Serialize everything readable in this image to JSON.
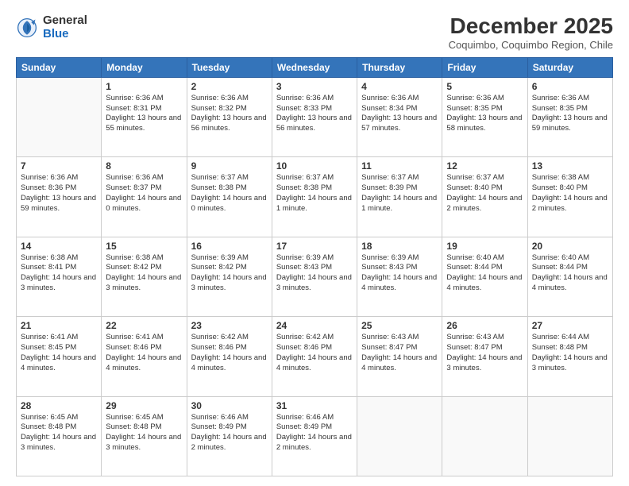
{
  "logo": {
    "general": "General",
    "blue": "Blue"
  },
  "header": {
    "month": "December 2025",
    "location": "Coquimbo, Coquimbo Region, Chile"
  },
  "weekdays": [
    "Sunday",
    "Monday",
    "Tuesday",
    "Wednesday",
    "Thursday",
    "Friday",
    "Saturday"
  ],
  "weeks": [
    [
      {
        "day": "",
        "sunrise": "",
        "sunset": "",
        "daylight": ""
      },
      {
        "day": "1",
        "sunrise": "Sunrise: 6:36 AM",
        "sunset": "Sunset: 8:31 PM",
        "daylight": "Daylight: 13 hours and 55 minutes."
      },
      {
        "day": "2",
        "sunrise": "Sunrise: 6:36 AM",
        "sunset": "Sunset: 8:32 PM",
        "daylight": "Daylight: 13 hours and 56 minutes."
      },
      {
        "day": "3",
        "sunrise": "Sunrise: 6:36 AM",
        "sunset": "Sunset: 8:33 PM",
        "daylight": "Daylight: 13 hours and 56 minutes."
      },
      {
        "day": "4",
        "sunrise": "Sunrise: 6:36 AM",
        "sunset": "Sunset: 8:34 PM",
        "daylight": "Daylight: 13 hours and 57 minutes."
      },
      {
        "day": "5",
        "sunrise": "Sunrise: 6:36 AM",
        "sunset": "Sunset: 8:35 PM",
        "daylight": "Daylight: 13 hours and 58 minutes."
      },
      {
        "day": "6",
        "sunrise": "Sunrise: 6:36 AM",
        "sunset": "Sunset: 8:35 PM",
        "daylight": "Daylight: 13 hours and 59 minutes."
      }
    ],
    [
      {
        "day": "7",
        "sunrise": "Sunrise: 6:36 AM",
        "sunset": "Sunset: 8:36 PM",
        "daylight": "Daylight: 13 hours and 59 minutes."
      },
      {
        "day": "8",
        "sunrise": "Sunrise: 6:36 AM",
        "sunset": "Sunset: 8:37 PM",
        "daylight": "Daylight: 14 hours and 0 minutes."
      },
      {
        "day": "9",
        "sunrise": "Sunrise: 6:37 AM",
        "sunset": "Sunset: 8:38 PM",
        "daylight": "Daylight: 14 hours and 0 minutes."
      },
      {
        "day": "10",
        "sunrise": "Sunrise: 6:37 AM",
        "sunset": "Sunset: 8:38 PM",
        "daylight": "Daylight: 14 hours and 1 minute."
      },
      {
        "day": "11",
        "sunrise": "Sunrise: 6:37 AM",
        "sunset": "Sunset: 8:39 PM",
        "daylight": "Daylight: 14 hours and 1 minute."
      },
      {
        "day": "12",
        "sunrise": "Sunrise: 6:37 AM",
        "sunset": "Sunset: 8:40 PM",
        "daylight": "Daylight: 14 hours and 2 minutes."
      },
      {
        "day": "13",
        "sunrise": "Sunrise: 6:38 AM",
        "sunset": "Sunset: 8:40 PM",
        "daylight": "Daylight: 14 hours and 2 minutes."
      }
    ],
    [
      {
        "day": "14",
        "sunrise": "Sunrise: 6:38 AM",
        "sunset": "Sunset: 8:41 PM",
        "daylight": "Daylight: 14 hours and 3 minutes."
      },
      {
        "day": "15",
        "sunrise": "Sunrise: 6:38 AM",
        "sunset": "Sunset: 8:42 PM",
        "daylight": "Daylight: 14 hours and 3 minutes."
      },
      {
        "day": "16",
        "sunrise": "Sunrise: 6:39 AM",
        "sunset": "Sunset: 8:42 PM",
        "daylight": "Daylight: 14 hours and 3 minutes."
      },
      {
        "day": "17",
        "sunrise": "Sunrise: 6:39 AM",
        "sunset": "Sunset: 8:43 PM",
        "daylight": "Daylight: 14 hours and 3 minutes."
      },
      {
        "day": "18",
        "sunrise": "Sunrise: 6:39 AM",
        "sunset": "Sunset: 8:43 PM",
        "daylight": "Daylight: 14 hours and 4 minutes."
      },
      {
        "day": "19",
        "sunrise": "Sunrise: 6:40 AM",
        "sunset": "Sunset: 8:44 PM",
        "daylight": "Daylight: 14 hours and 4 minutes."
      },
      {
        "day": "20",
        "sunrise": "Sunrise: 6:40 AM",
        "sunset": "Sunset: 8:44 PM",
        "daylight": "Daylight: 14 hours and 4 minutes."
      }
    ],
    [
      {
        "day": "21",
        "sunrise": "Sunrise: 6:41 AM",
        "sunset": "Sunset: 8:45 PM",
        "daylight": "Daylight: 14 hours and 4 minutes."
      },
      {
        "day": "22",
        "sunrise": "Sunrise: 6:41 AM",
        "sunset": "Sunset: 8:46 PM",
        "daylight": "Daylight: 14 hours and 4 minutes."
      },
      {
        "day": "23",
        "sunrise": "Sunrise: 6:42 AM",
        "sunset": "Sunset: 8:46 PM",
        "daylight": "Daylight: 14 hours and 4 minutes."
      },
      {
        "day": "24",
        "sunrise": "Sunrise: 6:42 AM",
        "sunset": "Sunset: 8:46 PM",
        "daylight": "Daylight: 14 hours and 4 minutes."
      },
      {
        "day": "25",
        "sunrise": "Sunrise: 6:43 AM",
        "sunset": "Sunset: 8:47 PM",
        "daylight": "Daylight: 14 hours and 4 minutes."
      },
      {
        "day": "26",
        "sunrise": "Sunrise: 6:43 AM",
        "sunset": "Sunset: 8:47 PM",
        "daylight": "Daylight: 14 hours and 3 minutes."
      },
      {
        "day": "27",
        "sunrise": "Sunrise: 6:44 AM",
        "sunset": "Sunset: 8:48 PM",
        "daylight": "Daylight: 14 hours and 3 minutes."
      }
    ],
    [
      {
        "day": "28",
        "sunrise": "Sunrise: 6:45 AM",
        "sunset": "Sunset: 8:48 PM",
        "daylight": "Daylight: 14 hours and 3 minutes."
      },
      {
        "day": "29",
        "sunrise": "Sunrise: 6:45 AM",
        "sunset": "Sunset: 8:48 PM",
        "daylight": "Daylight: 14 hours and 3 minutes."
      },
      {
        "day": "30",
        "sunrise": "Sunrise: 6:46 AM",
        "sunset": "Sunset: 8:49 PM",
        "daylight": "Daylight: 14 hours and 2 minutes."
      },
      {
        "day": "31",
        "sunrise": "Sunrise: 6:46 AM",
        "sunset": "Sunset: 8:49 PM",
        "daylight": "Daylight: 14 hours and 2 minutes."
      },
      {
        "day": "",
        "sunrise": "",
        "sunset": "",
        "daylight": ""
      },
      {
        "day": "",
        "sunrise": "",
        "sunset": "",
        "daylight": ""
      },
      {
        "day": "",
        "sunrise": "",
        "sunset": "",
        "daylight": ""
      }
    ]
  ]
}
